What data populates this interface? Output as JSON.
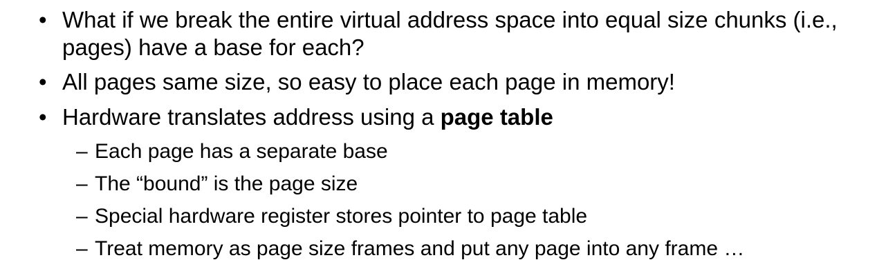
{
  "bullets": [
    {
      "marker": "•",
      "text": "What if we break the entire virtual address space into equal size chunks (i.e., pages) have a base for each?"
    },
    {
      "marker": "•",
      "text": "All pages same size, so easy to place each page in memory!"
    },
    {
      "marker": "•",
      "text_prefix": "Hardware translates address using a ",
      "text_bold": "page table",
      "sub_items": [
        {
          "marker": "–",
          "text": "Each page has a separate base"
        },
        {
          "marker": "–",
          "text": "The “bound” is the page size"
        },
        {
          "marker": "–",
          "text": "Special hardware register stores pointer to page table"
        },
        {
          "marker": "–",
          "text": "Treat memory as page size frames and put any page into any frame …"
        }
      ]
    }
  ]
}
